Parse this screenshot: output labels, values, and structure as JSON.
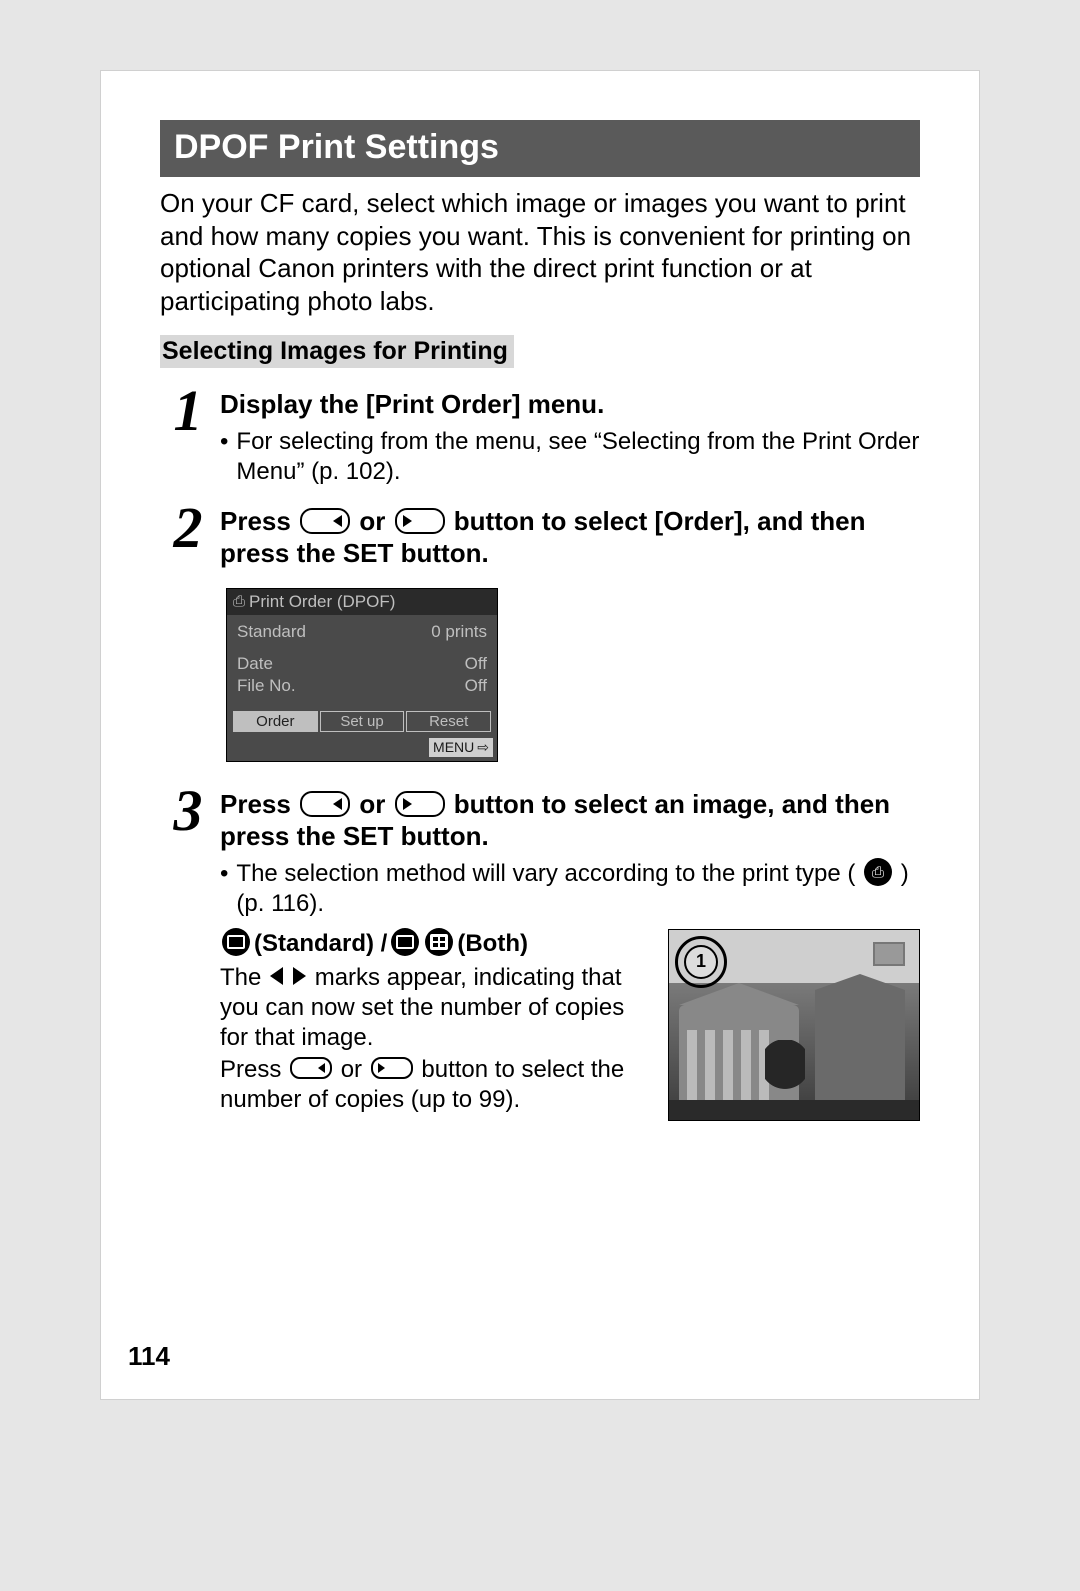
{
  "header": {
    "title": "DPOF Print Settings"
  },
  "intro": "On your CF card, select which image or images you want to print and how many copies you want. This is convenient for printing on optional Canon printers with the direct print function or at participating photo labs.",
  "sub_heading": "Selecting Images for Printing",
  "steps": {
    "s1": {
      "num": "1",
      "title": "Display the [Print Order] menu.",
      "bullet": "For selecting from the menu, see “Selecting from the Print Order Menu” (p. 102)."
    },
    "s2": {
      "num": "2",
      "title_a": "Press ",
      "title_b": " or ",
      "title_c": " button to select [Order], and then press the SET button."
    },
    "s3": {
      "num": "3",
      "title_a": "Press ",
      "title_b": " or ",
      "title_c": " button to select an image, and then press the SET button.",
      "bullet_a": "The selection method will vary according to the print type (",
      "bullet_b": ")(p. 116).",
      "sub_a": " (Standard) / ",
      "sub_b": " (Both)",
      "body_a": "The ",
      "body_b": " marks appear, indicating that you can now set the number of copies for that image.",
      "body_c_a": "Press ",
      "body_c_b": " or ",
      "body_c_c": " button to select the number of copies (up to 99)."
    }
  },
  "lcd1": {
    "header_icon": "⎙",
    "header": "Print Order (DPOF)",
    "row1": {
      "l": "Standard",
      "r": "0 prints"
    },
    "row2": {
      "l": "Date",
      "r": "Off"
    },
    "row3": {
      "l": "File No.",
      "r": "Off"
    },
    "tabs": {
      "order": "Order",
      "setup": "Set up",
      "reset": "Reset"
    },
    "menu": "MENU",
    "menu_icon": "⇨"
  },
  "lcd2": {
    "badge": "1"
  },
  "page_number": "114"
}
